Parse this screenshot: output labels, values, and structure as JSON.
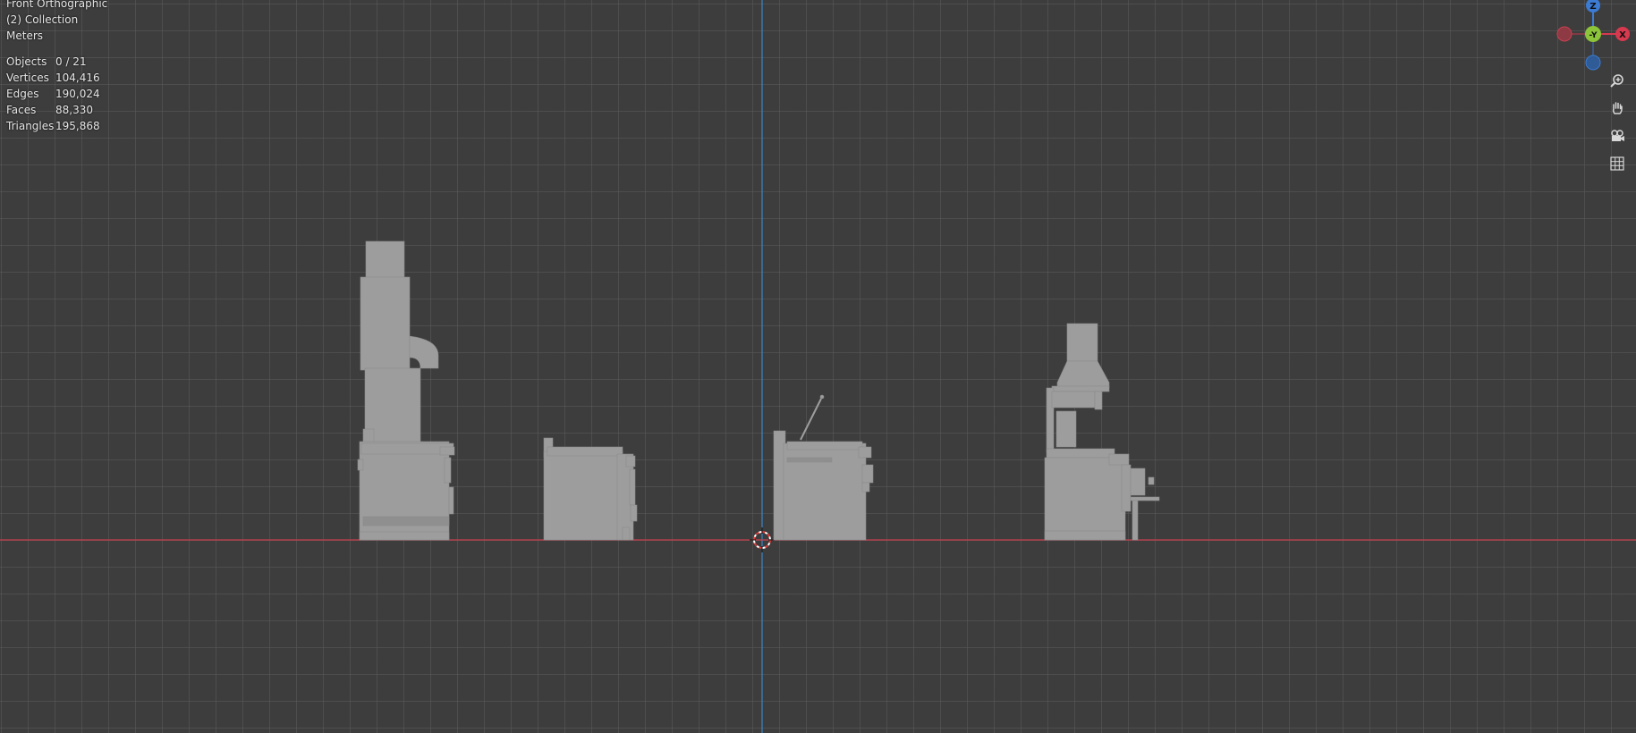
{
  "viewport": {
    "view_name": "Front Orthographic",
    "collection": "(2) Collection",
    "units": "Meters"
  },
  "stats": [
    {
      "label": "Objects",
      "value": "0 / 21"
    },
    {
      "label": "Vertices",
      "value": "104,416"
    },
    {
      "label": "Edges",
      "value": "190,024"
    },
    {
      "label": "Faces",
      "value": "88,330"
    },
    {
      "label": "Triangles",
      "value": "195,868"
    }
  ],
  "nav_gizmo": {
    "z_label": "Z",
    "y_label": "-Y",
    "x_label": "X",
    "colors": {
      "x": "#d8394f",
      "y": "#8cc43a",
      "z": "#3b7bd4"
    }
  },
  "nav_buttons": [
    {
      "name": "zoom-icon"
    },
    {
      "name": "pan-hand-icon"
    },
    {
      "name": "camera-view-icon"
    },
    {
      "name": "orthographic-grid-icon"
    }
  ],
  "colors": {
    "x_axis": "#c8404f",
    "z_axis": "#3d86c9",
    "mesh": "#9d9d9d"
  }
}
